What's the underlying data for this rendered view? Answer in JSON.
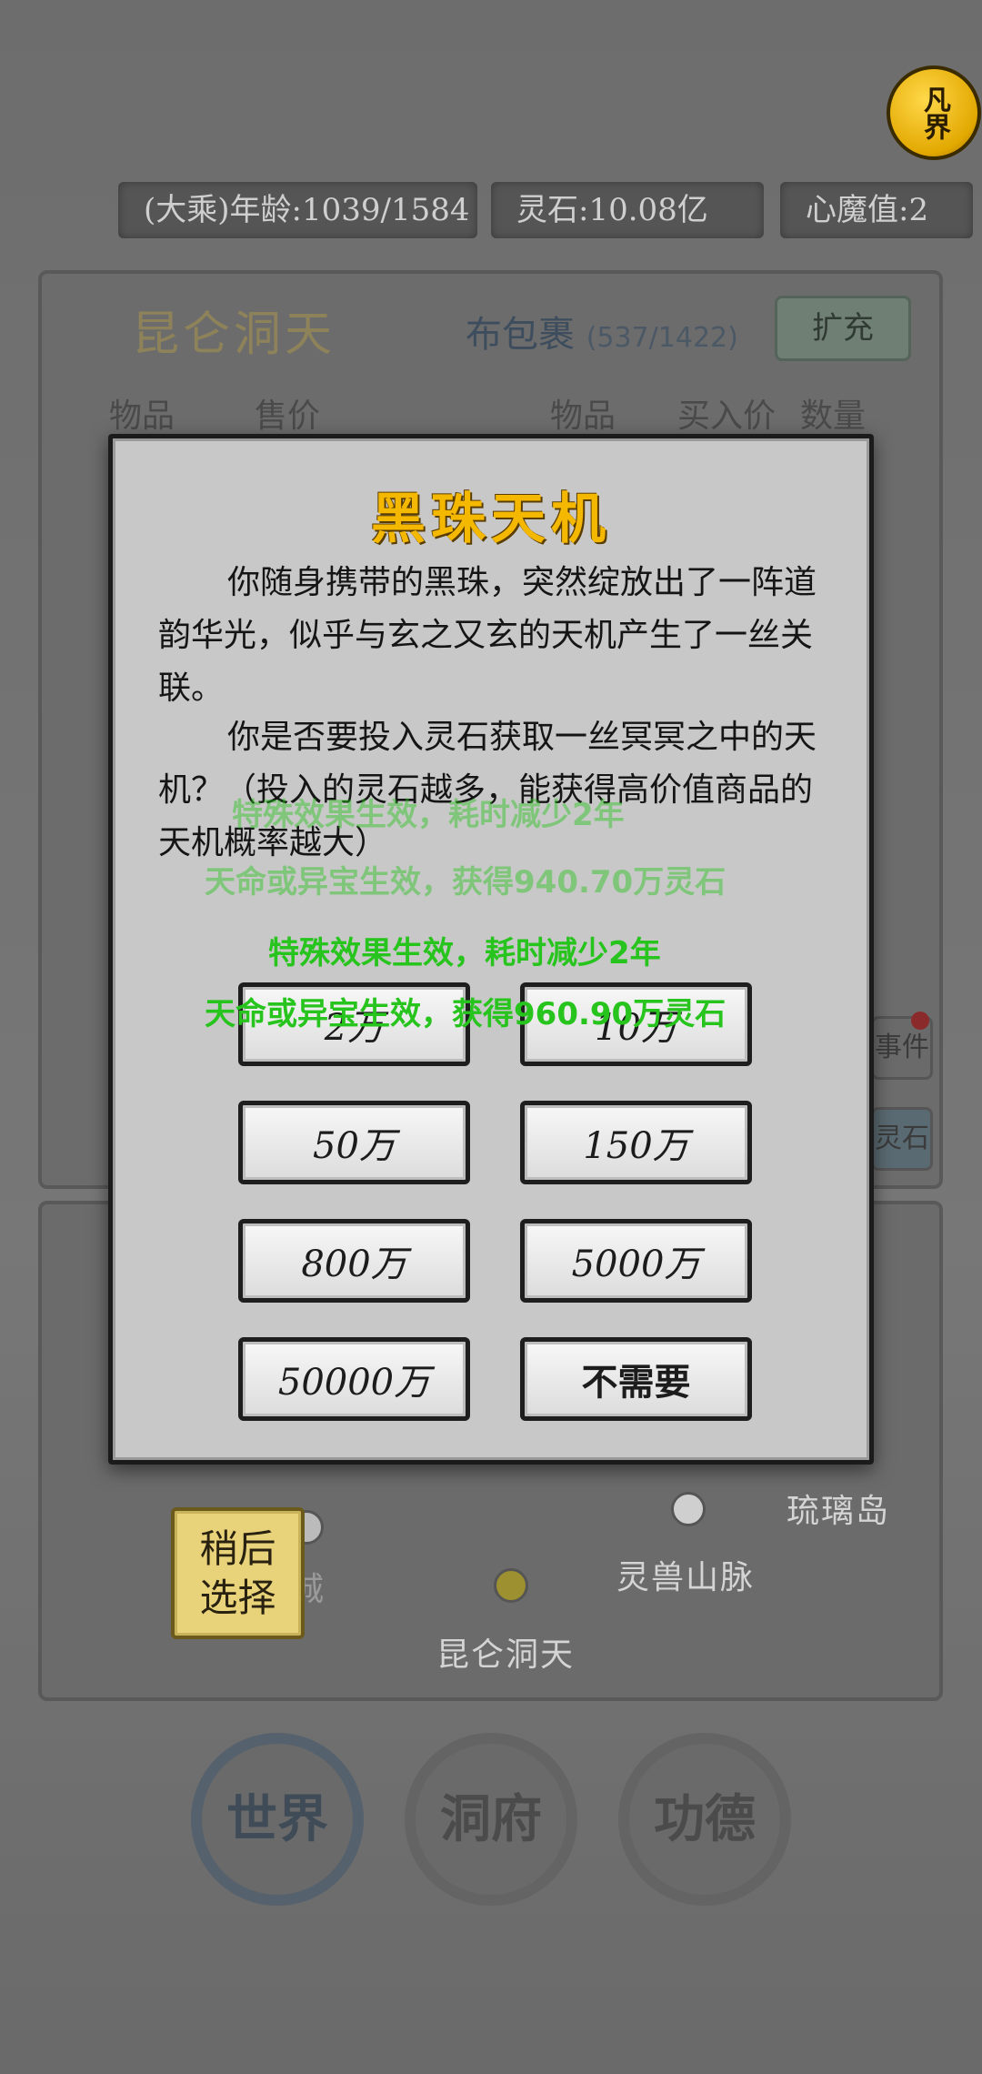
{
  "top_bar": {
    "age": "(大乘)年龄:1039/1584",
    "spirit_stone": "灵石:10.08亿",
    "heart_demon": "心魔值:2",
    "logo_text": "凡界"
  },
  "shop": {
    "title": "昆仑洞天",
    "bag_label": "布包裹",
    "bag_count": "(537/1422)",
    "expand_button": "扩充",
    "headers": [
      "物品",
      "售价",
      "物品",
      "买入价",
      "数量"
    ],
    "side_buttons": [
      "事件",
      "灵石"
    ]
  },
  "dialog": {
    "title": "黑珠天机",
    "paragraph1": "你随身携带的黑珠，突然绽放出了一阵道韵华光，似乎与玄之又玄的天机产生了一丝关联。",
    "paragraph2": "你是否要投入灵石获取一丝冥冥之中的天机？（投入的灵石越多，能获得高价值商品的天机概率越大）",
    "amount_buttons": [
      "2万",
      "10万",
      "50万",
      "150万",
      "800万",
      "5000万",
      "50000万"
    ],
    "decline_button": "不需要"
  },
  "notices": [
    "特殊效果生效，耗时减少2年",
    "天命或异宝生效，获得940.70万灵石",
    "特殊效果生效，耗时减少2年",
    "天命或异宝生效，获得960.90万灵石"
  ],
  "later_button": "稍后选择",
  "map": {
    "locations": [
      "琉璃岛",
      "灵兽山脉",
      "昆仑洞天",
      "城"
    ]
  },
  "nav": {
    "world": "世界",
    "cave": "洞府",
    "merit": "功德"
  }
}
